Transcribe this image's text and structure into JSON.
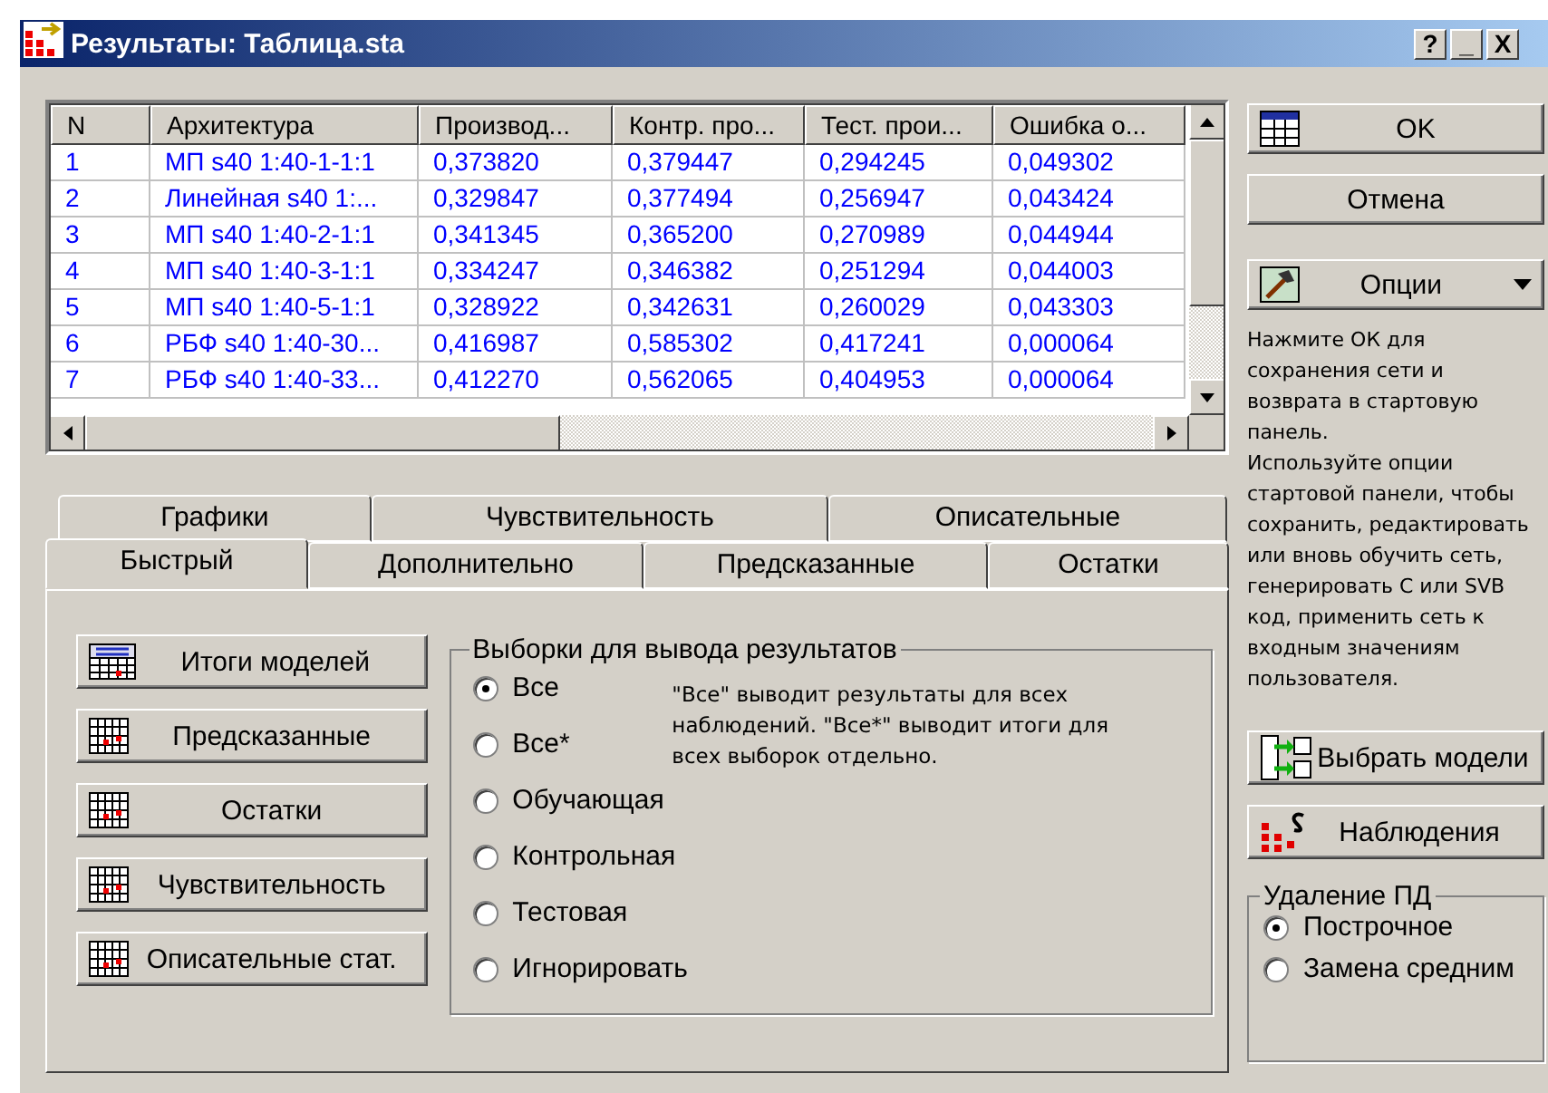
{
  "window": {
    "title": "Результаты: Таблица.sta",
    "controls": [
      "?",
      "_",
      "X"
    ]
  },
  "table": {
    "columns": [
      "N",
      "Архитектура",
      "Производ...",
      "Контр. про...",
      "Тест. прои...",
      "Ошибка о..."
    ],
    "rows": [
      [
        "1",
        "МП s40 1:40-1-1:1",
        "0,373820",
        "0,379447",
        "0,294245",
        "0,049302"
      ],
      [
        "2",
        "Линейная s40 1:...",
        "0,329847",
        "0,377494",
        "0,256947",
        "0,043424"
      ],
      [
        "3",
        "МП s40 1:40-2-1:1",
        "0,341345",
        "0,365200",
        "0,270989",
        "0,044944"
      ],
      [
        "4",
        "МП s40 1:40-3-1:1",
        "0,334247",
        "0,346382",
        "0,251294",
        "0,044003"
      ],
      [
        "5",
        "МП s40 1:40-5-1:1",
        "0,328922",
        "0,342631",
        "0,260029",
        "0,043303"
      ],
      [
        "6",
        "РБФ s40 1:40-30...",
        "0,416987",
        "0,585302",
        "0,417241",
        "0,000064"
      ],
      [
        "7",
        "РБФ s40 1:40-33...",
        "0,412270",
        "0,562065",
        "0,404953",
        "0,000064"
      ]
    ]
  },
  "side": {
    "buttons": [
      {
        "label": "OK"
      },
      {
        "label": "Отмена"
      },
      {
        "label": "Опции"
      }
    ],
    "help_text": [
      "Нажмите ОК для сохранения сети и возврата в стартовую панель.",
      "Используйте опции стартовой панели, чтобы сохранить, редактировать или вновь обучить сеть, генерировать C или SVB код, применить сеть к входным значениям пользователя."
    ],
    "lower_buttons": [
      {
        "label": "Выбрать модели"
      },
      {
        "label": "Наблюдения"
      }
    ],
    "missing_group": {
      "title": "Удаление ПД",
      "options": [
        {
          "label": "Построчное",
          "selected": true
        },
        {
          "label": "Замена средним",
          "selected": false
        }
      ]
    }
  },
  "tabs_upper_row": [
    {
      "label": "Графики",
      "selected": false
    },
    {
      "label": "Чувствительность",
      "selected": false
    },
    {
      "label": "Описательные",
      "selected": false
    }
  ],
  "tabs_lower_row": [
    {
      "label": "Быстрый",
      "selected": true
    },
    {
      "label": "Дополнительно",
      "selected": false
    },
    {
      "label": "Предсказанные",
      "selected": false
    },
    {
      "label": "Остатки",
      "selected": false
    }
  ],
  "quick": {
    "buttons": [
      {
        "label": "Итоги моделей"
      },
      {
        "label": "Предсказанные"
      },
      {
        "label": "Остатки"
      },
      {
        "label": "Чувствительность"
      },
      {
        "label": "Описательные стат."
      }
    ],
    "samples_group": {
      "title": "Выборки для вывода результатов",
      "options": [
        {
          "label": "Все",
          "selected": true
        },
        {
          "label": "Все*",
          "selected": false
        },
        {
          "label": "Обучающая",
          "selected": false
        },
        {
          "label": "Контрольная",
          "selected": false
        },
        {
          "label": "Тестовая",
          "selected": false
        },
        {
          "label": "Игнорировать",
          "selected": false
        }
      ],
      "note": "\"Все\" выводит результаты для всех наблюдений. \"Все*\" выводит итоги для всех выборок отдельно."
    }
  }
}
